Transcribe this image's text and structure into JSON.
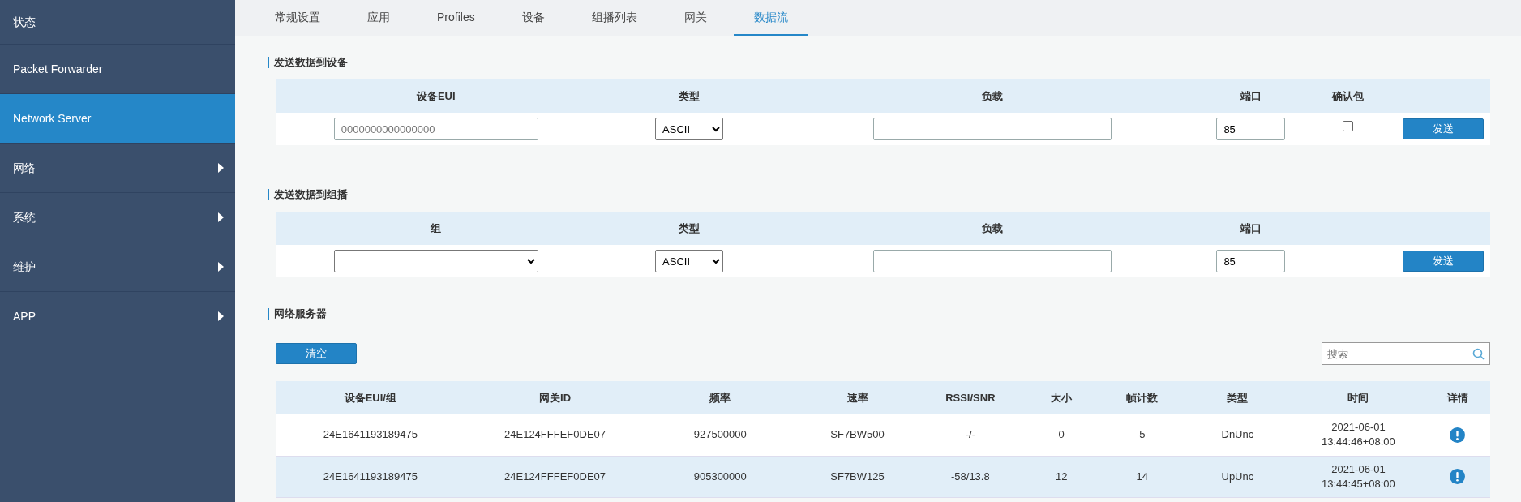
{
  "sidebar": {
    "items": [
      {
        "label": "状态",
        "selected": false,
        "has_submenu": false
      },
      {
        "label": "Packet Forwarder",
        "selected": false,
        "has_submenu": false
      },
      {
        "label": "Network Server",
        "selected": true,
        "has_submenu": false
      },
      {
        "label": "网络",
        "selected": false,
        "has_submenu": true
      },
      {
        "label": "系统",
        "selected": false,
        "has_submenu": true
      },
      {
        "label": "维护",
        "selected": false,
        "has_submenu": true
      },
      {
        "label": "APP",
        "selected": false,
        "has_submenu": true
      }
    ]
  },
  "tabs": [
    {
      "label": "常规设置",
      "selected": false
    },
    {
      "label": "应用",
      "selected": false
    },
    {
      "label": "Profiles",
      "selected": false
    },
    {
      "label": "设备",
      "selected": false
    },
    {
      "label": "组播列表",
      "selected": false
    },
    {
      "label": "网关",
      "selected": false
    },
    {
      "label": "数据流",
      "selected": true
    }
  ],
  "send_to_device": {
    "title": "发送数据到设备",
    "columns": [
      "设备EUI",
      "类型",
      "负载",
      "端口",
      "确认包"
    ],
    "eui": {
      "placeholder": "0000000000000000"
    },
    "type": "ASCII",
    "port": "85",
    "confirm": {
      "checked": false
    },
    "button": "发送"
  },
  "send_to_multicast": {
    "title": "发送数据到组播",
    "columns": [
      "组",
      "类型",
      "负载",
      "端口"
    ],
    "type": "ASCII",
    "port": "85",
    "button": "发送"
  },
  "network_server": {
    "title": "网络服务器",
    "clear_button": "清空",
    "search": {
      "placeholder": "搜索"
    },
    "columns": [
      "设备EUI/组",
      "网关ID",
      "频率",
      "速率",
      "RSSI/SNR",
      "大小",
      "帧计数",
      "类型",
      "时间",
      "详情"
    ],
    "rows": [
      {
        "highlighted": false,
        "cells": [
          "24E1641193189475",
          "24E124FFFEF0DE07",
          "927500000",
          "SF7BW500",
          "-/-",
          "0",
          "5",
          "DnUnc"
        ],
        "time": [
          "2021-06-01",
          "13:44:46+08:00"
        ]
      },
      {
        "highlighted": true,
        "cells": [
          "24E1641193189475",
          "24E124FFFEF0DE07",
          "905300000",
          "SF7BW125",
          "-58/13.8",
          "12",
          "14",
          "UpUnc"
        ],
        "time": [
          "2021-06-01",
          "13:44:45+08:00"
        ]
      }
    ]
  }
}
